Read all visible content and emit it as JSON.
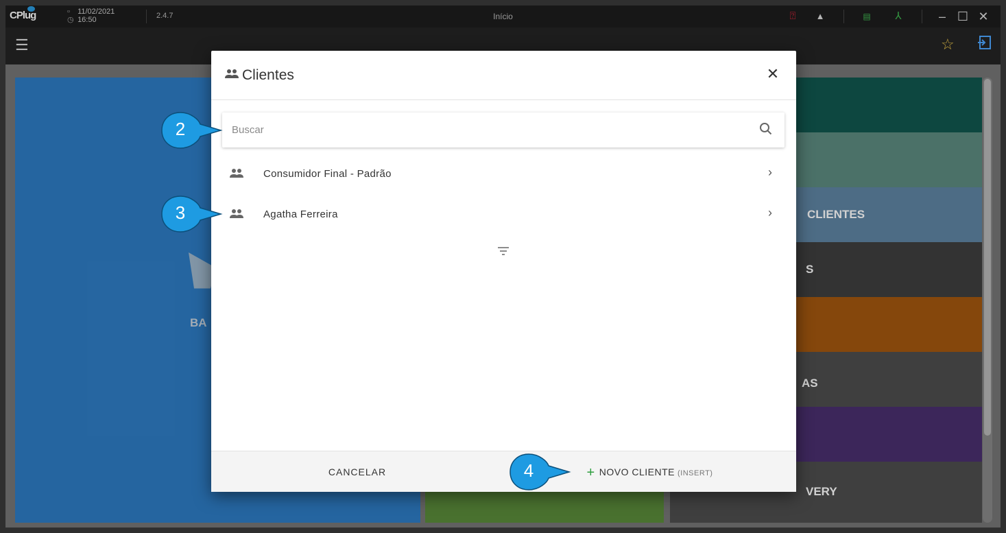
{
  "titlebar": {
    "logo": "CPlug",
    "date": "11/02/2021",
    "time": "16:50",
    "version": "2.4.7",
    "title": "Início"
  },
  "topbar": {
    "menu_icon": "hamburger-icon",
    "favorite_icon": "star-icon",
    "exit_icon": "exit-icon"
  },
  "background": {
    "left_tile_fragment": "BA",
    "right_tiles": [
      {
        "label": "",
        "color": "#11574f"
      },
      {
        "label": "",
        "color": "#5c8a7f"
      },
      {
        "label": "CLIENTES",
        "color": "#5e84a3"
      },
      {
        "label": "S",
        "color": "#3f3f3f"
      },
      {
        "label": "",
        "color": "#a3570f"
      },
      {
        "label": "AS",
        "color": "#4d4d4d"
      },
      {
        "label": "",
        "color": "#4a2f6e"
      },
      {
        "label": "VERY",
        "color": "#4d4d4d"
      }
    ]
  },
  "dialog": {
    "title": "Clientes",
    "search_placeholder": "Buscar",
    "search_value": "",
    "clients": [
      {
        "name": "Consumidor Final - Padrão"
      },
      {
        "name": "Agatha Ferreira"
      }
    ],
    "cancel_label": "CANCELAR",
    "new_label": "NOVO CLIENTE",
    "new_hint": "(INSERT)"
  },
  "callouts": [
    "2",
    "3",
    "4"
  ],
  "colors": {
    "callout": "#1e9be2",
    "accent_green": "#2e9e3e",
    "help_red": "#e0243a"
  }
}
